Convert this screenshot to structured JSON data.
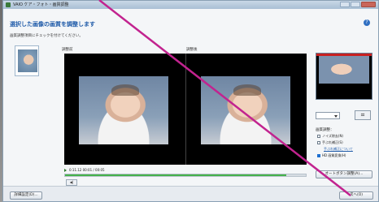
{
  "titlebar": {
    "title": "VAIO ケア・フォト・画質調整"
  },
  "header": {
    "heading": "選択した画像の画質を調整します",
    "subtext": "画質調整項目にチェックを付けてください。",
    "help_icon": "?"
  },
  "preview": {
    "before_label": "調整前",
    "after_label": "調整後",
    "timecode": "0:11.12 00:01 / 00:05",
    "progress_fraction": 0.92,
    "step_button_label": "◀|"
  },
  "adjust": {
    "select_value": "",
    "crop_button_icon": "crop-icon",
    "section_title": "画質調整：",
    "options": [
      {
        "label": "ノイズ除去(N)",
        "checked": false
      },
      {
        "label": "手ぶれ補正(S)",
        "checked": false
      },
      {
        "label": "HD 画質変換(H)",
        "checked": true
      }
    ],
    "link": "手ぶれ補正について",
    "detail_button": "オートボタン調整(A)..."
  },
  "footer": {
    "left_button": "詳細設定(D)...",
    "right_button": "次へ(O)"
  },
  "colors": {
    "accent": "#1e5aa8",
    "progress": "#45b24a",
    "pointer": "#c2238f"
  }
}
